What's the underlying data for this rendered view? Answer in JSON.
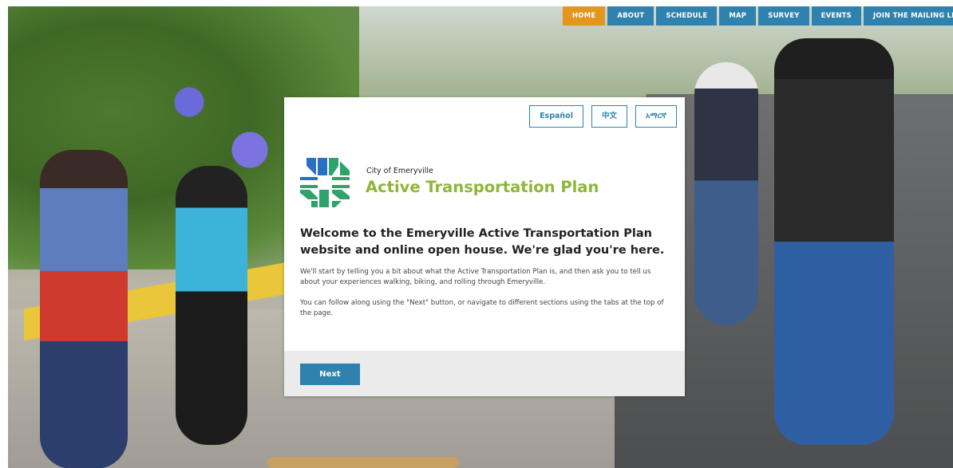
{
  "nav": {
    "tabs": [
      {
        "label": "HOME",
        "active": true
      },
      {
        "label": "ABOUT",
        "active": false
      },
      {
        "label": "SCHEDULE",
        "active": false
      },
      {
        "label": "MAP",
        "active": false
      },
      {
        "label": "SURVEY",
        "active": false
      },
      {
        "label": "EVENTS",
        "active": false
      },
      {
        "label": "JOIN THE MAILING LIS",
        "active": false
      }
    ]
  },
  "languages": {
    "spanish": "Español",
    "chinese": "中文",
    "amharic": "አማርኛ"
  },
  "header": {
    "org": "City of Emeryville",
    "title": "Active Transportation Plan"
  },
  "content": {
    "welcome": "Welcome to the Emeryville Active Transportation Plan website and online open house. We're glad you're here.",
    "paragraph_1": "We'll start by telling you a bit about what the Active Transportation Plan is, and then ask you to tell us about your experiences walking, biking, and rolling through Emeryville.",
    "paragraph_2": "You can follow along using the \"Next\" button, or navigate to different sections using the tabs at the top of the page."
  },
  "footer": {
    "next_label": "Next"
  },
  "colors": {
    "nav_blue": "#2f82ad",
    "nav_active": "#e2961d",
    "title_green": "#8fb63a",
    "logo_blue": "#2a6fc0",
    "logo_green": "#2fa36b"
  },
  "background": {
    "icon": "street-photo-background"
  }
}
